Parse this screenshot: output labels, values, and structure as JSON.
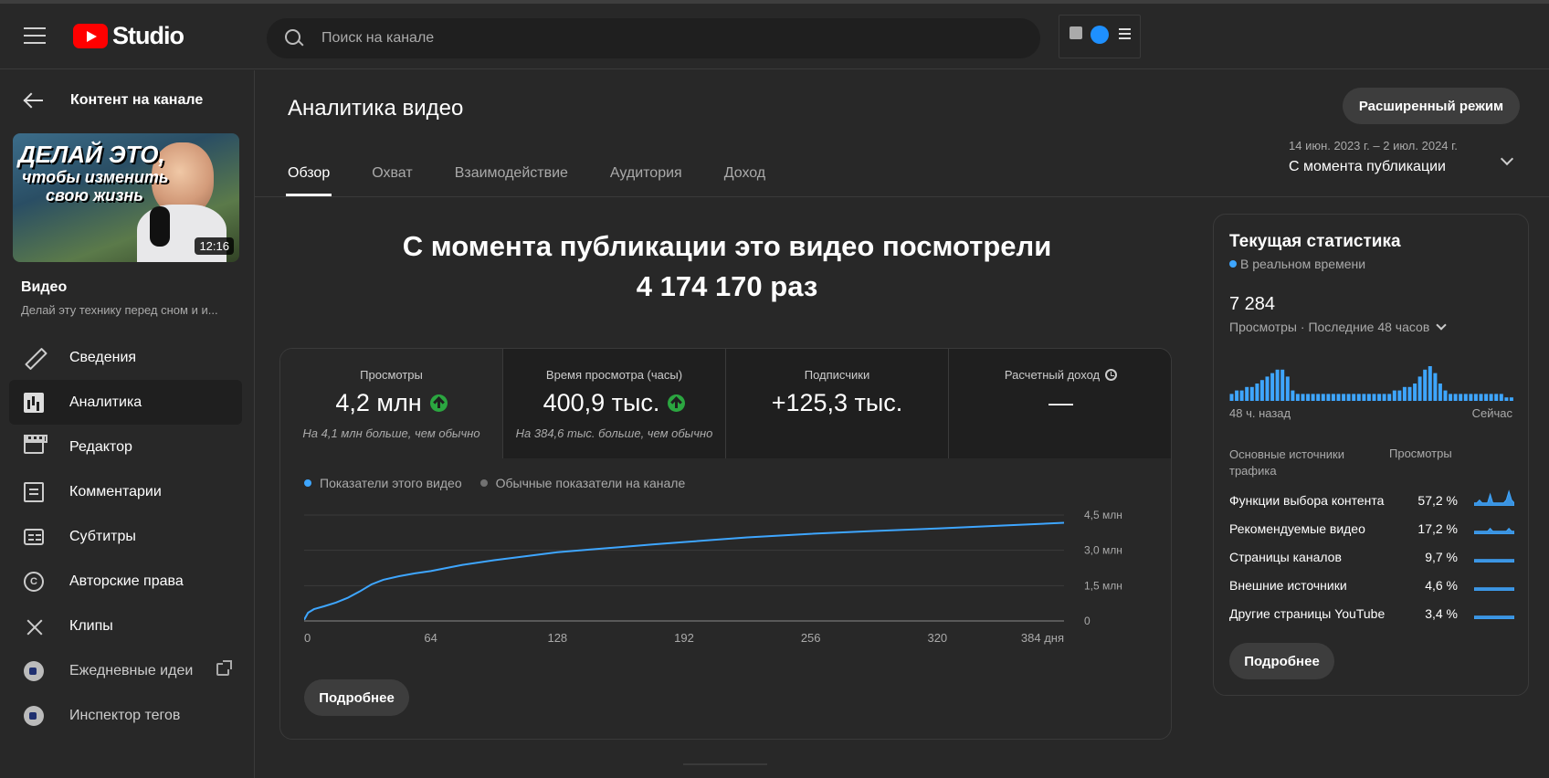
{
  "app": {
    "logo_text": "Studio"
  },
  "search": {
    "placeholder": "Поиск на канале"
  },
  "sidebar": {
    "back_label": "Контент на канале",
    "thumbnail": {
      "line1": "ДЕЛАЙ ЭТО,",
      "line2": "чтобы изменить",
      "line3": "свою жизнь",
      "duration": "12:16"
    },
    "video_label": "Видео",
    "video_title": "Делай эту технику перед сном и и...",
    "items": [
      {
        "label": "Сведения",
        "icon": "pencil-icon"
      },
      {
        "label": "Аналитика",
        "icon": "analytics-icon",
        "active": true
      },
      {
        "label": "Редактор",
        "icon": "clapperboard-icon"
      },
      {
        "label": "Комментарии",
        "icon": "comment-icon"
      },
      {
        "label": "Субтитры",
        "icon": "subtitles-icon"
      },
      {
        "label": "Авторские права",
        "icon": "copyright-icon"
      },
      {
        "label": "Клипы",
        "icon": "scissors-icon"
      },
      {
        "label": "Ежедневные идеи",
        "icon": "extension-icon"
      },
      {
        "label": "Инспектор тегов",
        "icon": "extension-icon"
      }
    ]
  },
  "main": {
    "title": "Аналитика видео",
    "advanced_button": "Расширенный режим",
    "tabs": [
      "Обзор",
      "Охват",
      "Взаимодействие",
      "Аудитория",
      "Доход"
    ],
    "date_range": {
      "dates": "14 июн. 2023 г. – 2 июл. 2024 г.",
      "label": "С момента публикации"
    },
    "headline_line1": "С момента публикации это видео посмотрели",
    "headline_line2": "4 174 170 раз",
    "metrics": [
      {
        "label": "Просмотры",
        "value": "4,2 млн",
        "note": "На 4,1 млн больше, чем обычно"
      },
      {
        "label": "Время просмотра (часы)",
        "value": "400,9 тыс.",
        "note": "На 384,6 тыс. больше, чем обычно"
      },
      {
        "label": "Подписчики",
        "value": "+125,3 тыс."
      },
      {
        "label": "Расчетный доход",
        "value": "—"
      }
    ],
    "legend": {
      "this_video": "Показатели этого видео",
      "typical": "Обычные показатели на канале"
    },
    "more_button": "Подробнее"
  },
  "colors": {
    "series": "#3ea6ff",
    "typical": "#717171",
    "up": "#2ba640"
  },
  "chart_data": {
    "type": "line",
    "x": [
      0,
      2,
      5,
      10,
      16,
      22,
      28,
      34,
      40,
      48,
      56,
      64,
      80,
      96,
      112,
      128,
      144,
      160,
      176,
      192,
      224,
      256,
      288,
      320,
      352,
      384
    ],
    "series": [
      {
        "values": [
          0.05,
          0.35,
          0.5,
          0.62,
          0.78,
          0.98,
          1.25,
          1.55,
          1.75,
          1.9,
          2.02,
          2.12,
          2.38,
          2.58,
          2.75,
          2.92,
          3.03,
          3.14,
          3.25,
          3.35,
          3.55,
          3.7,
          3.82,
          3.93,
          4.05,
          4.17
        ]
      }
    ],
    "x_ticks": [
      "0",
      "64",
      "128",
      "192",
      "256",
      "320",
      "384 дня"
    ],
    "y_ticks": [
      "0",
      "1,5 млн",
      "3,0 млн",
      "4,5 млн"
    ],
    "ylim": [
      0,
      4.5
    ],
    "xlim": [
      0,
      384
    ]
  },
  "realtime": {
    "title": "Текущая статистика",
    "live": "В реальном времени",
    "views": "7 284",
    "period": "Просмотры · Последние 48 часов",
    "bars": [
      2,
      3,
      3,
      4,
      4,
      5,
      6,
      7,
      8,
      9,
      9,
      7,
      3,
      2,
      2,
      2,
      2,
      2,
      2,
      2,
      2,
      2,
      2,
      2,
      2,
      2,
      2,
      2,
      2,
      2,
      2,
      2,
      3,
      3,
      4,
      4,
      5,
      7,
      9,
      10,
      8,
      5,
      3,
      2,
      2,
      2,
      2,
      2,
      2,
      2,
      2,
      2,
      2,
      2,
      1,
      1
    ],
    "ago_label": "48 ч. назад",
    "now_label": "Сейчас",
    "sources_header": "Основные источники трафика",
    "views_header": "Просмотры",
    "sources": [
      {
        "name": "Функции выбора контента",
        "pct": "57,2 %",
        "spark": [
          1,
          1,
          2,
          1,
          1,
          1,
          4,
          1,
          1,
          1,
          1,
          1,
          2,
          5,
          2,
          1
        ]
      },
      {
        "name": "Рекомендуемые видео",
        "pct": "17,2 %",
        "spark": [
          1,
          1,
          1,
          1,
          1,
          1,
          2,
          1,
          1,
          1,
          1,
          1,
          1,
          2,
          1,
          1
        ]
      },
      {
        "name": "Страницы каналов",
        "pct": "9,7 %",
        "spark": [
          1,
          1,
          1,
          1,
          1,
          1,
          1,
          1,
          1,
          1,
          1,
          1,
          1,
          1,
          1,
          1
        ]
      },
      {
        "name": "Внешние источники",
        "pct": "4,6 %",
        "spark": [
          1,
          1,
          1,
          1,
          1,
          1,
          1,
          1,
          1,
          1,
          1,
          1,
          1,
          1,
          1,
          1
        ]
      },
      {
        "name": "Другие страницы YouTube",
        "pct": "3,4 %",
        "spark": [
          1,
          1,
          1,
          1,
          1,
          1,
          1,
          1,
          1,
          1,
          1,
          1,
          1,
          1,
          1,
          1
        ]
      }
    ],
    "more_button": "Подробнее"
  }
}
